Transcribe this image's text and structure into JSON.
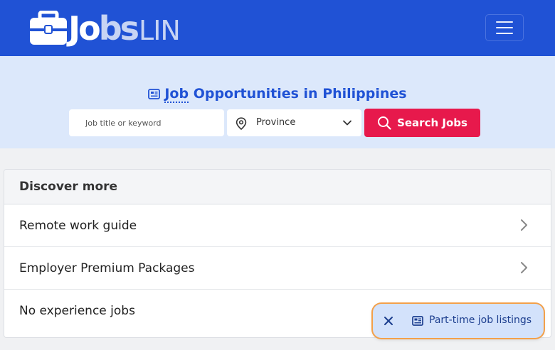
{
  "brand": {
    "logo_jo": "Jo",
    "logo_b": "b",
    "logo_s": "s",
    "logo_lin": "LIN"
  },
  "hero": {
    "title_abbr": "Job",
    "title_rest": " Opportunities in Philippines",
    "keyword_placeholder": "Job title or keyword",
    "province_value": "Province",
    "search_label": "Search Jobs"
  },
  "discover": {
    "header": "Discover more",
    "items": [
      {
        "label": "Remote work guide"
      },
      {
        "label": "Employer Premium Packages"
      },
      {
        "label": "No experience jobs"
      }
    ]
  },
  "toast": {
    "label": "Part-time job listings"
  },
  "colors": {
    "navbar": "#2052d5",
    "hero_bg": "#dce8fb",
    "search_button": "#e7194c",
    "accent_text": "#2052d5"
  }
}
